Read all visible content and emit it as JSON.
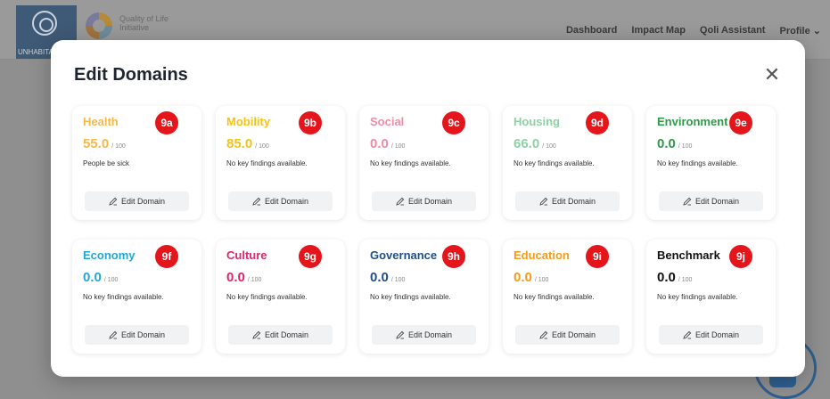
{
  "header": {
    "un_logo_text": "UNHABITAT",
    "app_logo_text": "Quality of Life Initiative",
    "nav": [
      "Dashboard",
      "Impact Map",
      "Qoli Assistant",
      "Profile"
    ]
  },
  "modal": {
    "title": "Edit Domains",
    "close_icon": "close-icon",
    "edit_label": "Edit Domain",
    "out_of": "/ 100"
  },
  "domains": [
    {
      "name": "Health",
      "badge": "9a",
      "score": "55.0",
      "finding": "People be sick",
      "color": "#f7b84b"
    },
    {
      "name": "Mobility",
      "badge": "9b",
      "score": "85.0",
      "finding": "No key findings available.",
      "color": "#f3c316"
    },
    {
      "name": "Social",
      "badge": "9c",
      "score": "0.0",
      "finding": "No key findings available.",
      "color": "#f28aa6"
    },
    {
      "name": "Housing",
      "badge": "9d",
      "score": "66.0",
      "finding": "No key findings available.",
      "color": "#8fd1a6"
    },
    {
      "name": "Environment",
      "badge": "9e",
      "score": "0.0",
      "finding": "No key findings available.",
      "color": "#2f9b4a"
    },
    {
      "name": "Economy",
      "badge": "9f",
      "score": "0.0",
      "finding": "No key findings available.",
      "color": "#21a7d6"
    },
    {
      "name": "Culture",
      "badge": "9g",
      "score": "0.0",
      "finding": "No key findings available.",
      "color": "#e0246d"
    },
    {
      "name": "Governance",
      "badge": "9h",
      "score": "0.0",
      "finding": "No key findings available.",
      "color": "#1f4f8c"
    },
    {
      "name": "Education",
      "badge": "9i",
      "score": "0.0",
      "finding": "No key findings available.",
      "color": "#f59a1b"
    },
    {
      "name": "Benchmark",
      "badge": "9j",
      "score": "0.0",
      "finding": "No key findings available.",
      "color": "#111111"
    }
  ]
}
